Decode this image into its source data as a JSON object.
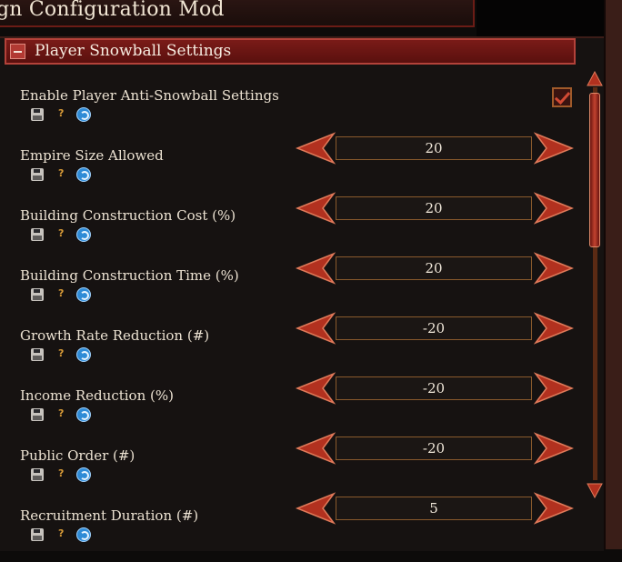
{
  "window": {
    "title": "gn Configuration Mod"
  },
  "section": {
    "title": "Player Snowball Settings"
  },
  "settings": [
    {
      "label": "Enable Player Anti-Snowball Settings",
      "type": "checkbox",
      "checked": true
    },
    {
      "label": "Empire Size Allowed",
      "type": "stepper",
      "value": "20"
    },
    {
      "label": "Building Construction Cost (%)",
      "type": "stepper",
      "value": "20"
    },
    {
      "label": "Building Construction Time (%)",
      "type": "stepper",
      "value": "20"
    },
    {
      "label": "Growth Rate Reduction (#)",
      "type": "stepper",
      "value": "-20"
    },
    {
      "label": "Income Reduction (%)",
      "type": "stepper",
      "value": "-20"
    },
    {
      "label": "Public Order (#)",
      "type": "stepper",
      "value": "-20"
    },
    {
      "label": "Recruitment Duration (#)",
      "type": "stepper",
      "value": "5"
    }
  ],
  "row_icons": {
    "help": "?",
    "icons": [
      "save-icon",
      "help-icon",
      "reset-icon"
    ]
  },
  "colors": {
    "accent": "#7a1b18",
    "text": "#e9dfcf",
    "arrow": "#c23a2a"
  }
}
